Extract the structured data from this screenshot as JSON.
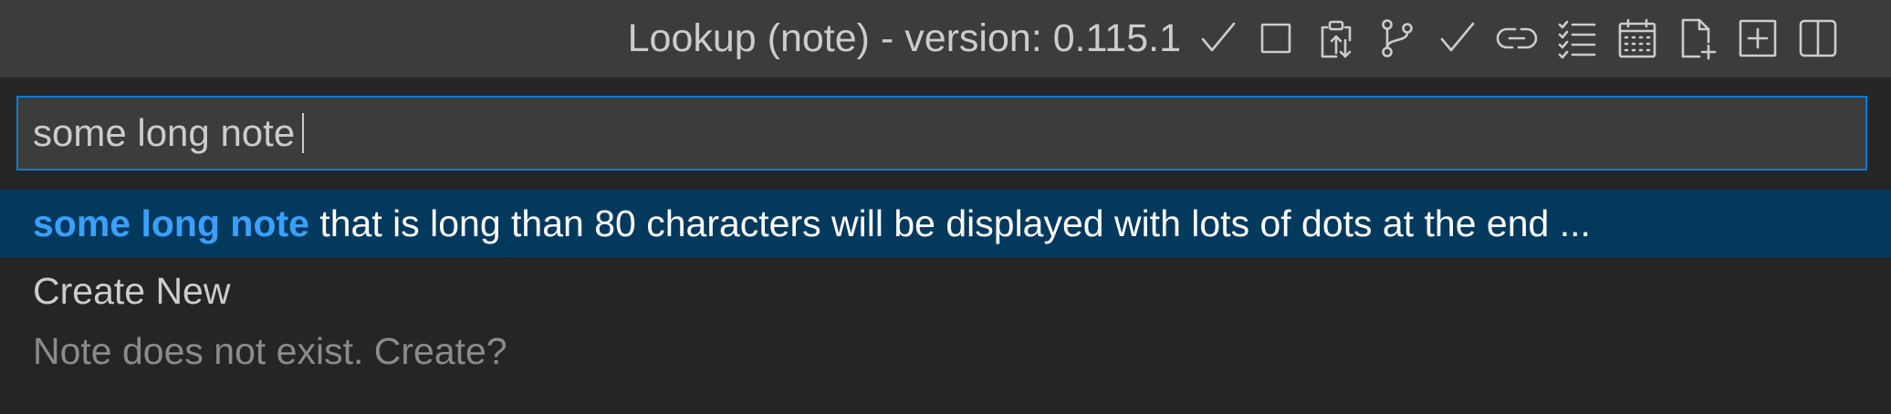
{
  "titlebar": {
    "title": "Lookup (note) - version: 0.115.1",
    "actions": [
      {
        "name": "checkmark-icon",
        "icon": "check"
      },
      {
        "name": "square-icon",
        "icon": "square"
      },
      {
        "name": "clipboard-copy-icon",
        "icon": "clipboard"
      },
      {
        "name": "branch-icon",
        "icon": "git-branch"
      },
      {
        "name": "checkmark-icon",
        "icon": "check"
      },
      {
        "name": "link-icon",
        "icon": "link"
      },
      {
        "name": "checklist-icon",
        "icon": "checklist"
      },
      {
        "name": "calendar-icon",
        "icon": "calendar"
      },
      {
        "name": "new-file-icon",
        "icon": "new-file"
      },
      {
        "name": "add-box-icon",
        "icon": "plus-square"
      },
      {
        "name": "split-editor-icon",
        "icon": "split"
      }
    ]
  },
  "search": {
    "value": "some long note"
  },
  "results": {
    "selected": {
      "match": "some long note",
      "rest": " that is long than 80 characters will be displayed with lots of dots at the end ..."
    },
    "create": {
      "label": "Create New",
      "description": "Note does not exist. Create?"
    }
  },
  "colors": {
    "titlebar_bg": "#3c3c3c",
    "panel_bg": "#252526",
    "focus_border": "#0e7ad3",
    "selected_bg": "#04395e",
    "highlight": "#3aa0ff",
    "description": "#8b8b8b"
  }
}
